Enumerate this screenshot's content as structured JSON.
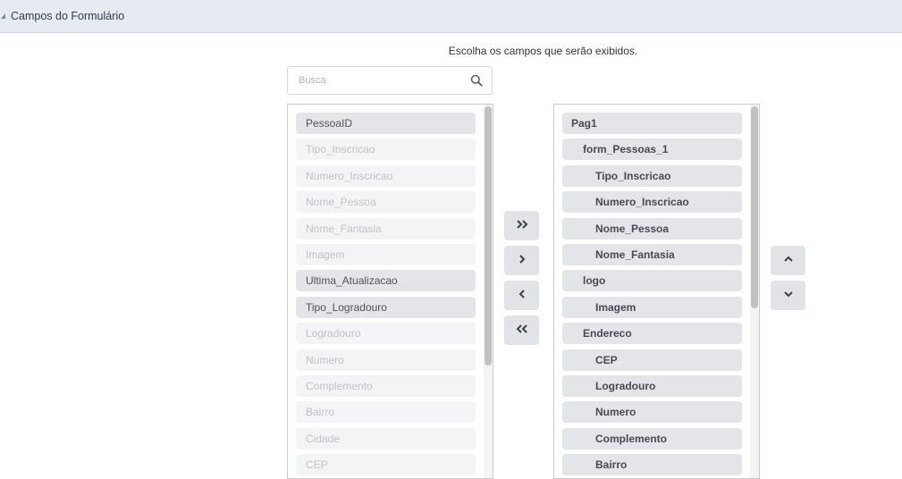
{
  "header": {
    "title": "Campos do Formulário"
  },
  "instruction": "Escolha os campos que serão exibidos.",
  "search": {
    "placeholder": "Busca",
    "value": ""
  },
  "available_fields": [
    {
      "label": "PessoaID",
      "active": true
    },
    {
      "label": "Tipo_Inscricao",
      "active": false
    },
    {
      "label": "Numero_Inscricao",
      "active": false
    },
    {
      "label": "Nome_Pessoa",
      "active": false
    },
    {
      "label": "Nome_Fantasia",
      "active": false
    },
    {
      "label": "Imagem",
      "active": false
    },
    {
      "label": "Ultima_Atualizacao",
      "active": true
    },
    {
      "label": "Tipo_Logradouro",
      "active": true
    },
    {
      "label": "Logradouro",
      "active": false
    },
    {
      "label": "Numero",
      "active": false
    },
    {
      "label": "Complemento",
      "active": false
    },
    {
      "label": "Bairro",
      "active": false
    },
    {
      "label": "Cidade",
      "active": false
    },
    {
      "label": "CEP",
      "active": false
    }
  ],
  "selected_fields": [
    {
      "label": "Pag1",
      "level": 0
    },
    {
      "label": "form_Pessoas_1",
      "level": 1
    },
    {
      "label": "Tipo_Inscricao",
      "level": 2
    },
    {
      "label": "Numero_Inscricao",
      "level": 2
    },
    {
      "label": "Nome_Pessoa",
      "level": 2
    },
    {
      "label": "Nome_Fantasia",
      "level": 2
    },
    {
      "label": "logo",
      "level": 1
    },
    {
      "label": "Imagem",
      "level": 2
    },
    {
      "label": "Endereco",
      "level": 1
    },
    {
      "label": "CEP",
      "level": 2
    },
    {
      "label": "Logradouro",
      "level": 2
    },
    {
      "label": "Numero",
      "level": 2
    },
    {
      "label": "Complemento",
      "level": 2
    },
    {
      "label": "Bairro",
      "level": 2
    }
  ],
  "transfer_buttons": [
    "move-all-right",
    "move-right",
    "move-left",
    "move-all-left"
  ],
  "order_buttons": [
    "move-up",
    "move-down"
  ],
  "icons": {
    "search": "search-icon",
    "collapse": "collapse-triangle-icon",
    "move_all_right": "double-chevron-right-icon",
    "move_right": "chevron-right-icon",
    "move_left": "chevron-left-icon",
    "move_all_left": "double-chevron-left-icon",
    "move_up": "chevron-up-icon",
    "move_down": "chevron-down-icon"
  },
  "colors": {
    "header_bg": "#e6ebf2",
    "item_bg": "#e4e5e8",
    "item_inactive_bg": "#f3f4f6",
    "item_text": "#474b51",
    "item_inactive_text": "#bfc2c7"
  }
}
